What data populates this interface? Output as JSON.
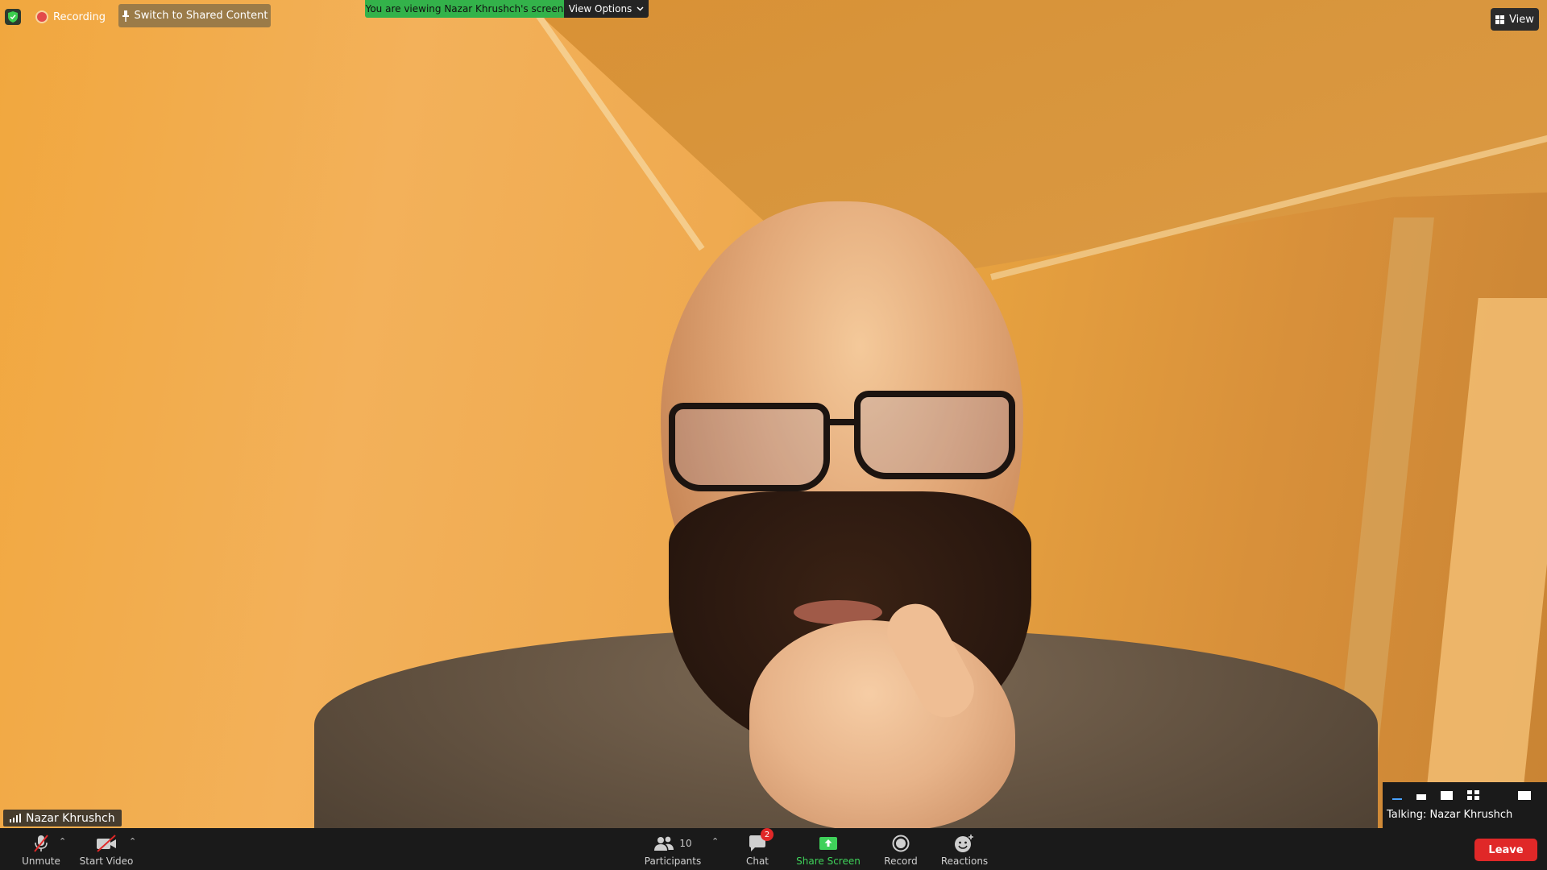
{
  "meeting": {
    "recording_label": "Recording",
    "switch_button_label": "Switch to Shared Content",
    "viewing_banner": "You are viewing Nazar Khrushch's screen",
    "view_options_label": "View Options",
    "view_button_label": "View"
  },
  "video": {
    "participant_name": "Nazar Khrushch"
  },
  "speaker_panel": {
    "talking_label": "Talking: Nazar Khrushch"
  },
  "toolbar": {
    "unmute_label": "Unmute",
    "start_video_label": "Start Video",
    "participants_label": "Participants",
    "participants_count": "10",
    "chat_label": "Chat",
    "chat_badge": "2",
    "share_screen_label": "Share Screen",
    "record_label": "Record",
    "reactions_label": "Reactions",
    "leave_label": "Leave"
  },
  "colors": {
    "toolbar_bg": "#1a1a1a",
    "share_green": "#3fd15a",
    "banner_green": "#33b24a",
    "leave_red": "#e02828",
    "recording_red": "#e34b4b"
  }
}
